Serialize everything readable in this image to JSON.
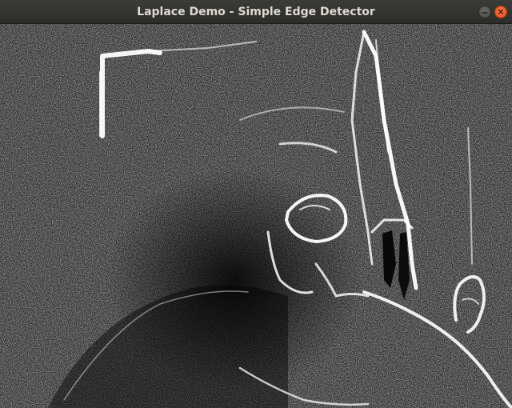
{
  "window": {
    "title": "Laplace Demo - Simple Edge Detector"
  },
  "controls": {
    "minimize_icon": "minimize-icon",
    "close_icon": "close-icon",
    "close_glyph": "×"
  },
  "colors": {
    "titlebar": "#2c2c2a",
    "title_text": "#dfdbd2",
    "close_button": "#df4a16",
    "edge": "#ffffff",
    "background": "#000000"
  }
}
